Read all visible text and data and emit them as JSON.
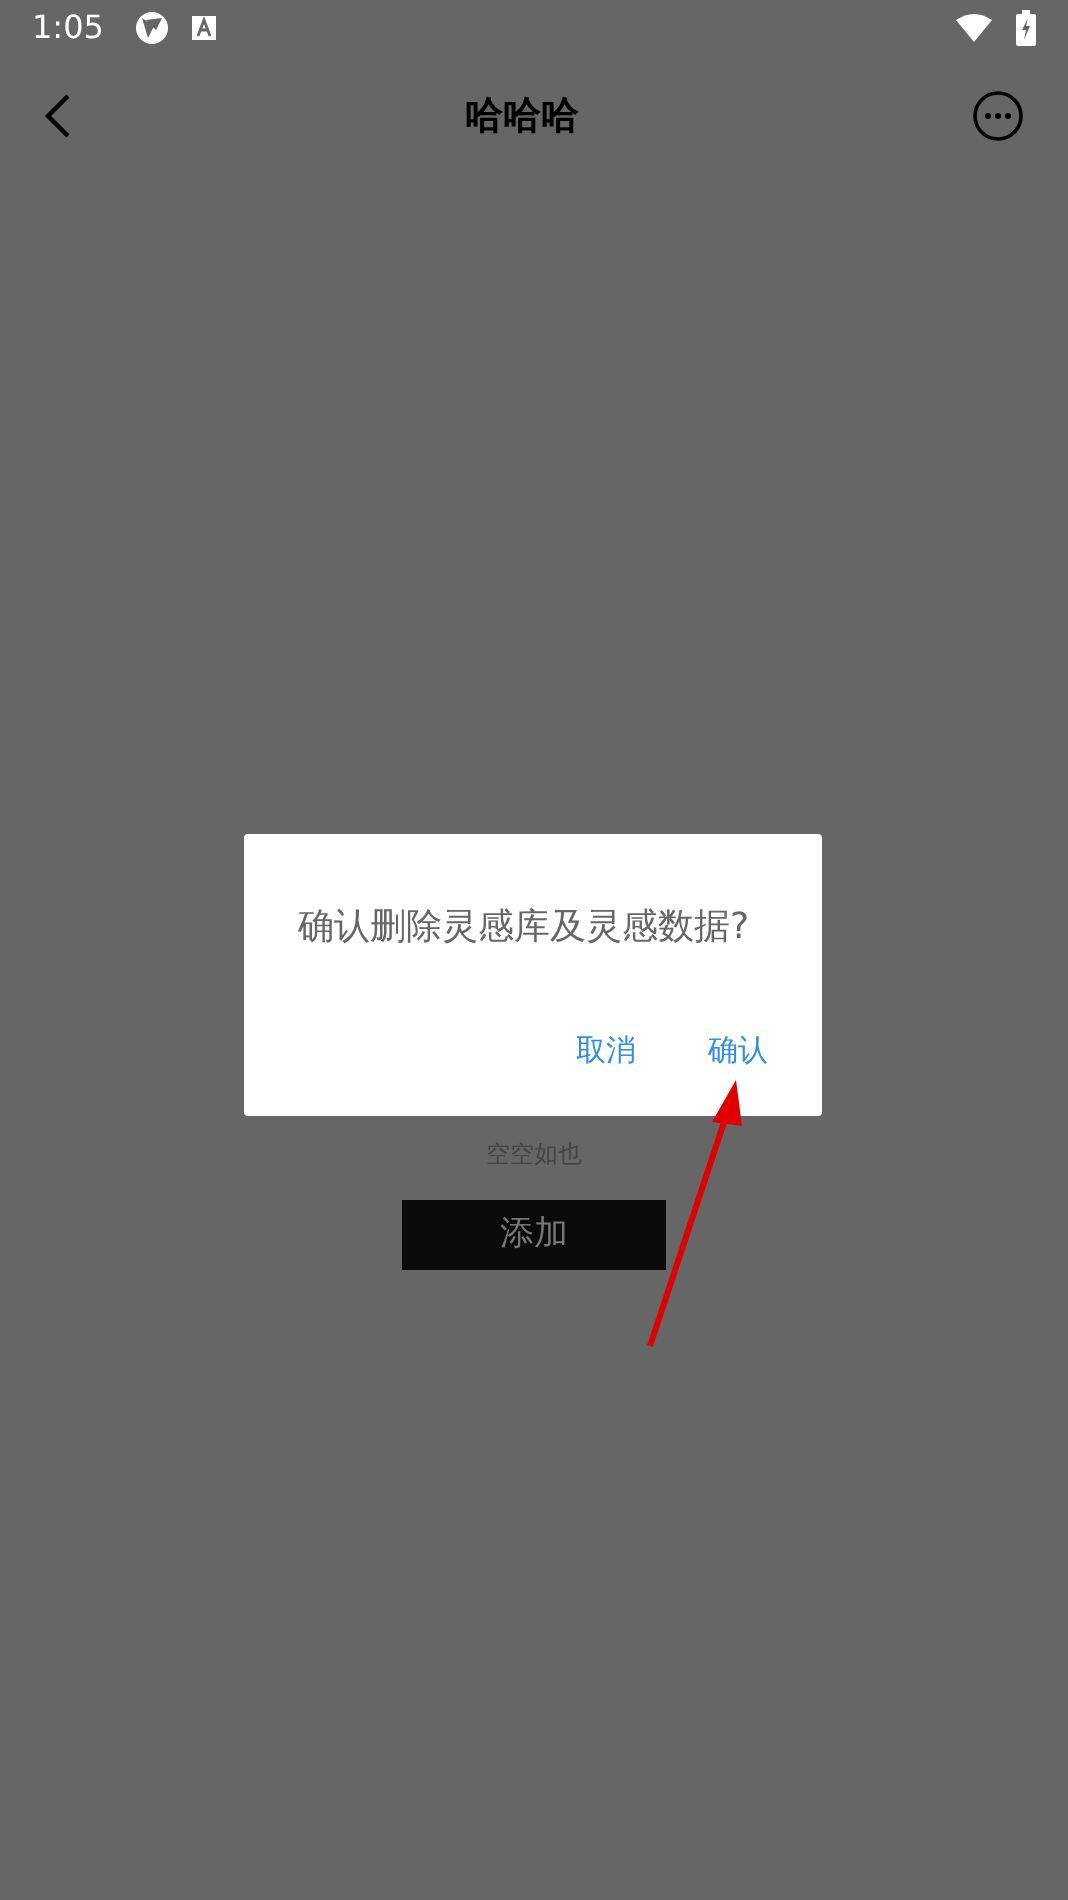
{
  "status_bar": {
    "time": "1:05"
  },
  "header": {
    "title": "哈哈哈"
  },
  "empty_state": {
    "message": "空空如也",
    "button": "添加"
  },
  "dialog": {
    "message": "确认删除灵感库及灵感数据?",
    "buttons": [
      "取消",
      "确认"
    ]
  }
}
